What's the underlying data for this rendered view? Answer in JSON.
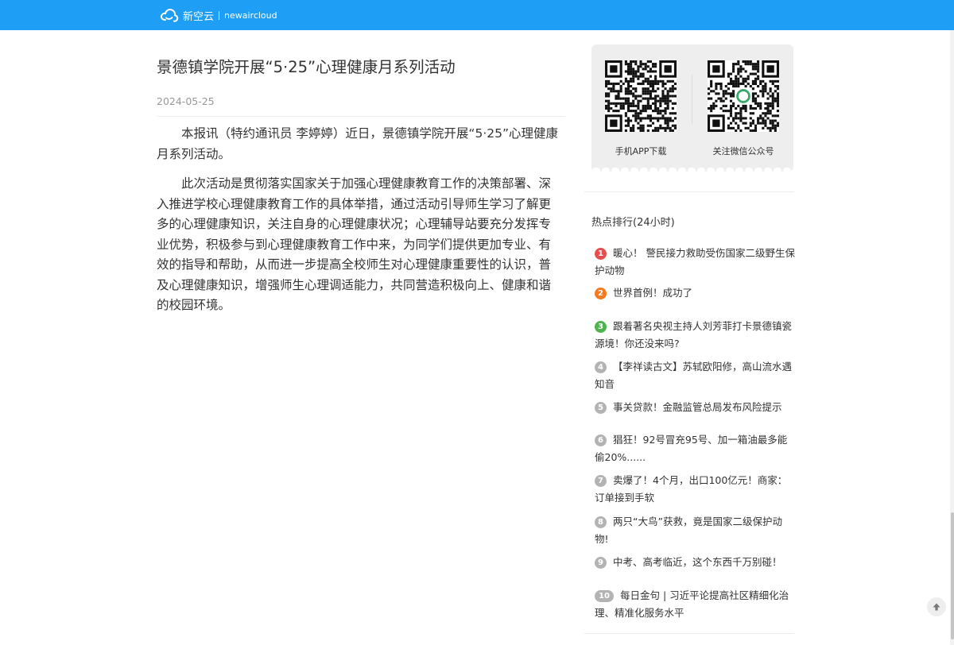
{
  "header": {
    "logo_cn": "新空云",
    "logo_en": "newaircloud",
    "background": "#1e9ef5"
  },
  "article": {
    "title": "景德镇学院开展“5·25”心理健康月系列活动",
    "date": "2024-05-25",
    "paragraphs": [
      "本报讯（特约通讯员 李婷婷）近日，景德镇学院开展“5·25”心理健康月系列活动。",
      "此次活动是贯彻落实国家关于加强心理健康教育工作的决策部署、深入推进学校心理健康教育工作的具体举措，通过活动引导师生学习了解更多的心理健康知识，关注自身的心理健康状况；心理辅导站要充分发挥专业优势，积极参与到心理健康教育工作中来，为同学们提供更加专业、有效的指导和帮助，从而进一步提高全校师生对心理健康重要性的认识，普及心理健康知识，增强师生心理调适能力，共同营造积极向上、健康和谐的校园环境。"
    ]
  },
  "sidebar": {
    "qr": [
      {
        "caption": "手机APP下载",
        "icon": "qr-code-icon"
      },
      {
        "caption": "关注微信公众号",
        "icon": "qr-code-icon"
      }
    ],
    "hot_title": "热点排行(24小时)",
    "hot_items": [
      {
        "rank": "1",
        "text": "暖心！ 警民接力救助受伤国家二级野生保护动物"
      },
      {
        "rank": "2",
        "text": "世界首例！成功了"
      },
      {
        "rank": "3",
        "text": "跟着著名央视主持人刘芳菲打卡景德镇瓷源境！你还没来吗?"
      },
      {
        "rank": "4",
        "text": "【李祥读古文】苏轼欧阳修，高山流水遇知音"
      },
      {
        "rank": "5",
        "text": "事关贷款！金融监管总局发布风险提示"
      },
      {
        "rank": "6",
        "text": "猖狂！92号冒充95号、加一箱油最多能偷20%......"
      },
      {
        "rank": "7",
        "text": "卖爆了！4个月，出口100亿元！商家：订单接到手软"
      },
      {
        "rank": "8",
        "text": "两只“大鸟”获救，竟是国家二级保护动物!"
      },
      {
        "rank": "9",
        "text": "中考、高考临近，这个东西千万别碰！"
      },
      {
        "rank": "10",
        "text": "每日金句 | 习近平论提高社区精细化治理、精准化服务水平"
      }
    ],
    "rank_colors": [
      "#e64f4f",
      "#f57a1f",
      "#4fb34f",
      "#b3b3b3"
    ]
  },
  "icons": {
    "back_to_top": "arrow-up-icon",
    "logo": "cloud-logo-icon"
  }
}
